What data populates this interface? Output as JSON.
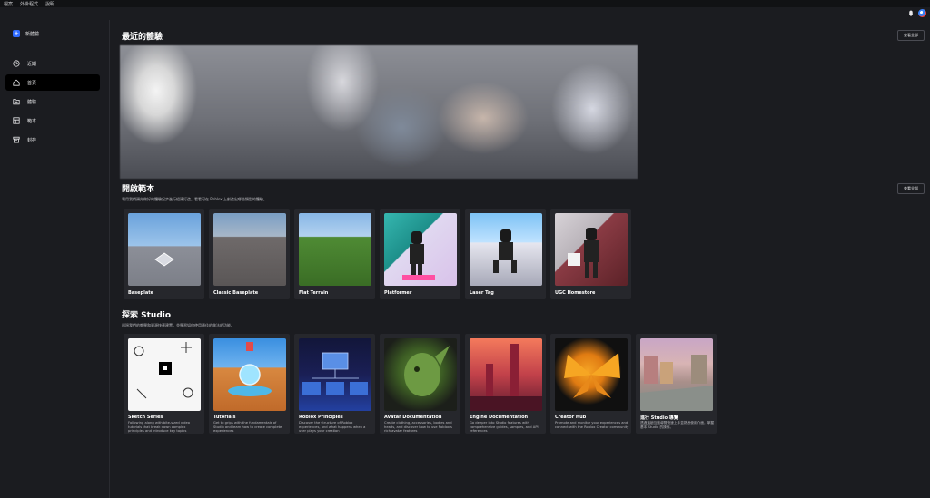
{
  "menubar": {
    "items": [
      "檔案",
      "外掛程式",
      "說明"
    ]
  },
  "topbar": {
    "icons": [
      "bell-icon",
      "avatar"
    ]
  },
  "sidebar": {
    "new_label": "新體驗",
    "items": [
      {
        "label": "近期",
        "icon": "clock-icon",
        "active": false
      },
      {
        "label": "首頁",
        "icon": "home-icon",
        "active": true
      },
      {
        "label": "體驗",
        "icon": "folder-icon",
        "active": false
      },
      {
        "label": "範本",
        "icon": "template-icon",
        "active": false
      },
      {
        "label": "封存",
        "icon": "archive-icon",
        "active": false
      }
    ]
  },
  "recent": {
    "title": "最近的體驗",
    "see_all": "查看全部"
  },
  "templates": {
    "title": "開啟範本",
    "subtitle": "利用我們預先做好的體驗起步進行組建打造。看看可在 Roblox 上創造出哪些類型的體驗。",
    "see_all": "查看全部",
    "items": [
      {
        "name": "Baseplate",
        "thumb": "t-baseplate"
      },
      {
        "name": "Classic Baseplate",
        "thumb": "t-classic"
      },
      {
        "name": "Flat Terrain",
        "thumb": "t-flat"
      },
      {
        "name": "Platformer",
        "thumb": "t-platformer"
      },
      {
        "name": "Laser Tag",
        "thumb": "t-laser"
      },
      {
        "name": "UGC Homestore",
        "thumb": "t-ugc"
      }
    ]
  },
  "explore": {
    "title": "探索 Studio",
    "subtitle": "透過我們的教學和資源快速建置，並學習如何使用最佳的做法的功能。",
    "items": [
      {
        "name": "Sketch Series",
        "desc": "Following along with bite-sized video tutorials that break down complex principles and introduce key topics",
        "thumb": "t-sketch"
      },
      {
        "name": "Tutorials",
        "desc": "Get to grips with the fundamentals of Studio and learn how to create complete experiences",
        "thumb": "t-tutorials"
      },
      {
        "name": "Roblox Principles",
        "desc": "Discover the structure of Roblox experiences, and what happens when a user plays your creation",
        "thumb": "t-principles"
      },
      {
        "name": "Avatar Documentation",
        "desc": "Create clothing, accessories, bodies and heads, and discover how to use Roblox's rich avatar features",
        "thumb": "t-avatar"
      },
      {
        "name": "Engine Documentation",
        "desc": "Go deeper into Studio features with comprehensive guides, samples, and API references",
        "thumb": "t-engine"
      },
      {
        "name": "Creator Hub",
        "desc": "Promote and monitor your experiences and connect with the Roblox Creator community",
        "thumb": "t-hub"
      },
      {
        "name": "進行 Studio 導覽",
        "desc": "透過這趟互動導覽快速上手並熟悉使用介面，掌握基本 Studio 的操作。",
        "thumb": "t-travel"
      }
    ]
  }
}
